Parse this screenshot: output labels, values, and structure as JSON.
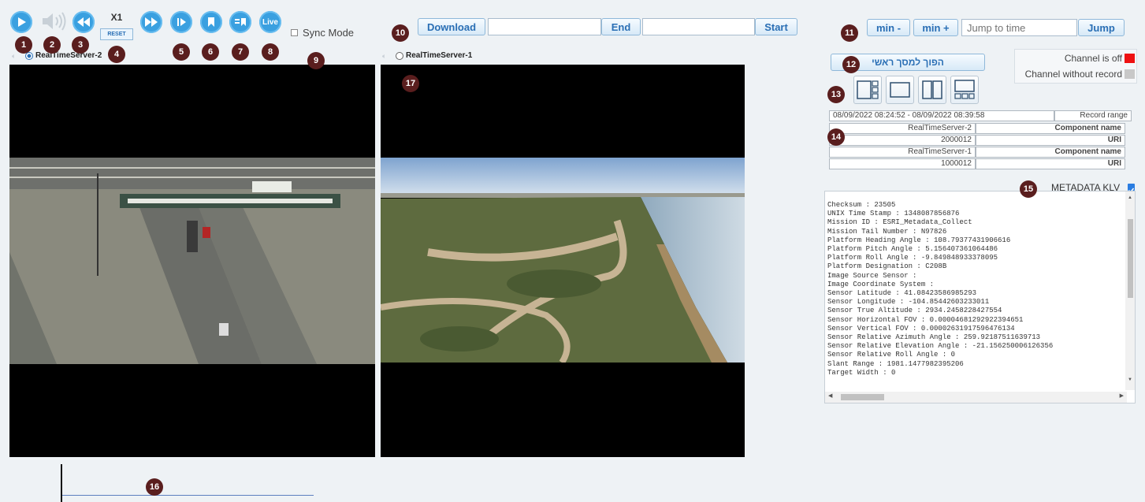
{
  "toolbar": {
    "speed_label": "X1",
    "reset_label": "RESET",
    "live_label": "Live",
    "sync_mode_label": "Sync Mode"
  },
  "download": {
    "download_label": "Download",
    "end_label": "End",
    "start_label": "Start",
    "end_value": "",
    "start_value": ""
  },
  "jump": {
    "min_minus_label": "min -",
    "min_plus_label": "min +",
    "placeholder": "Jump to time",
    "jump_label": "Jump"
  },
  "players": [
    {
      "name": "RealTimeServer-2"
    },
    {
      "name": "RealTimeServer-1"
    }
  ],
  "main_screen_button": "הפוך למסך ראשי",
  "legend": {
    "off_label": "Channel is off",
    "off_color": "#ee1111",
    "no_record_label": "Channel without record",
    "no_record_color": "#c8c8c8"
  },
  "info_table": {
    "record_range_value": "08/09/2022 08:24:52 - 08/09/2022 08:39:58",
    "record_range_label": "Record range",
    "rows": [
      {
        "value": "RealTimeServer-2",
        "label": "Component name"
      },
      {
        "value": "2000012",
        "label": "URI"
      },
      {
        "value": "RealTimeServer-1",
        "label": "Component name"
      },
      {
        "value": "1000012",
        "label": "URI"
      }
    ]
  },
  "metadata": {
    "title": "METADATA KLV",
    "lines": [
      "Checksum : 23505",
      "UNIX Time Stamp : 1348087856876",
      "Mission ID : ESRI_Metadata_Collect",
      "Mission Tail Number : N97826",
      "Platform Heading Angle : 108.79377431906616",
      "Platform Pitch Angle : 5.156407361064486",
      "Platform Roll Angle : -9.849848933378095",
      "Platform Designation : C208B",
      "Image Source Sensor :",
      "Image Coordinate System :",
      "Sensor Latitude : 41.08423586985293",
      "Sensor Longitude : -104.85442603233011",
      "Sensor True Altitude : 2934.2458228427554",
      "Sensor Horizontal FOV : 0.00004681292922394651",
      "Sensor Vertical FOV : 0.00002631917596476134",
      "Sensor Relative Azimuth Angle : 259.92187511639713",
      "Sensor Relative Elevation Angle : -21.156250006126356",
      "Sensor Relative Roll Angle : 0",
      "Slant Range : 1981.1477982395206",
      "Target Width : 0"
    ]
  },
  "badges": [
    "1",
    "2",
    "3",
    "4",
    "5",
    "6",
    "7",
    "8",
    "9",
    "10",
    "11",
    "12",
    "13",
    "14",
    "15",
    "16",
    "17"
  ],
  "colors": {
    "badge": "#5a1e1e",
    "accent": "#3aa0e0",
    "button_text": "#2a6fb5"
  }
}
